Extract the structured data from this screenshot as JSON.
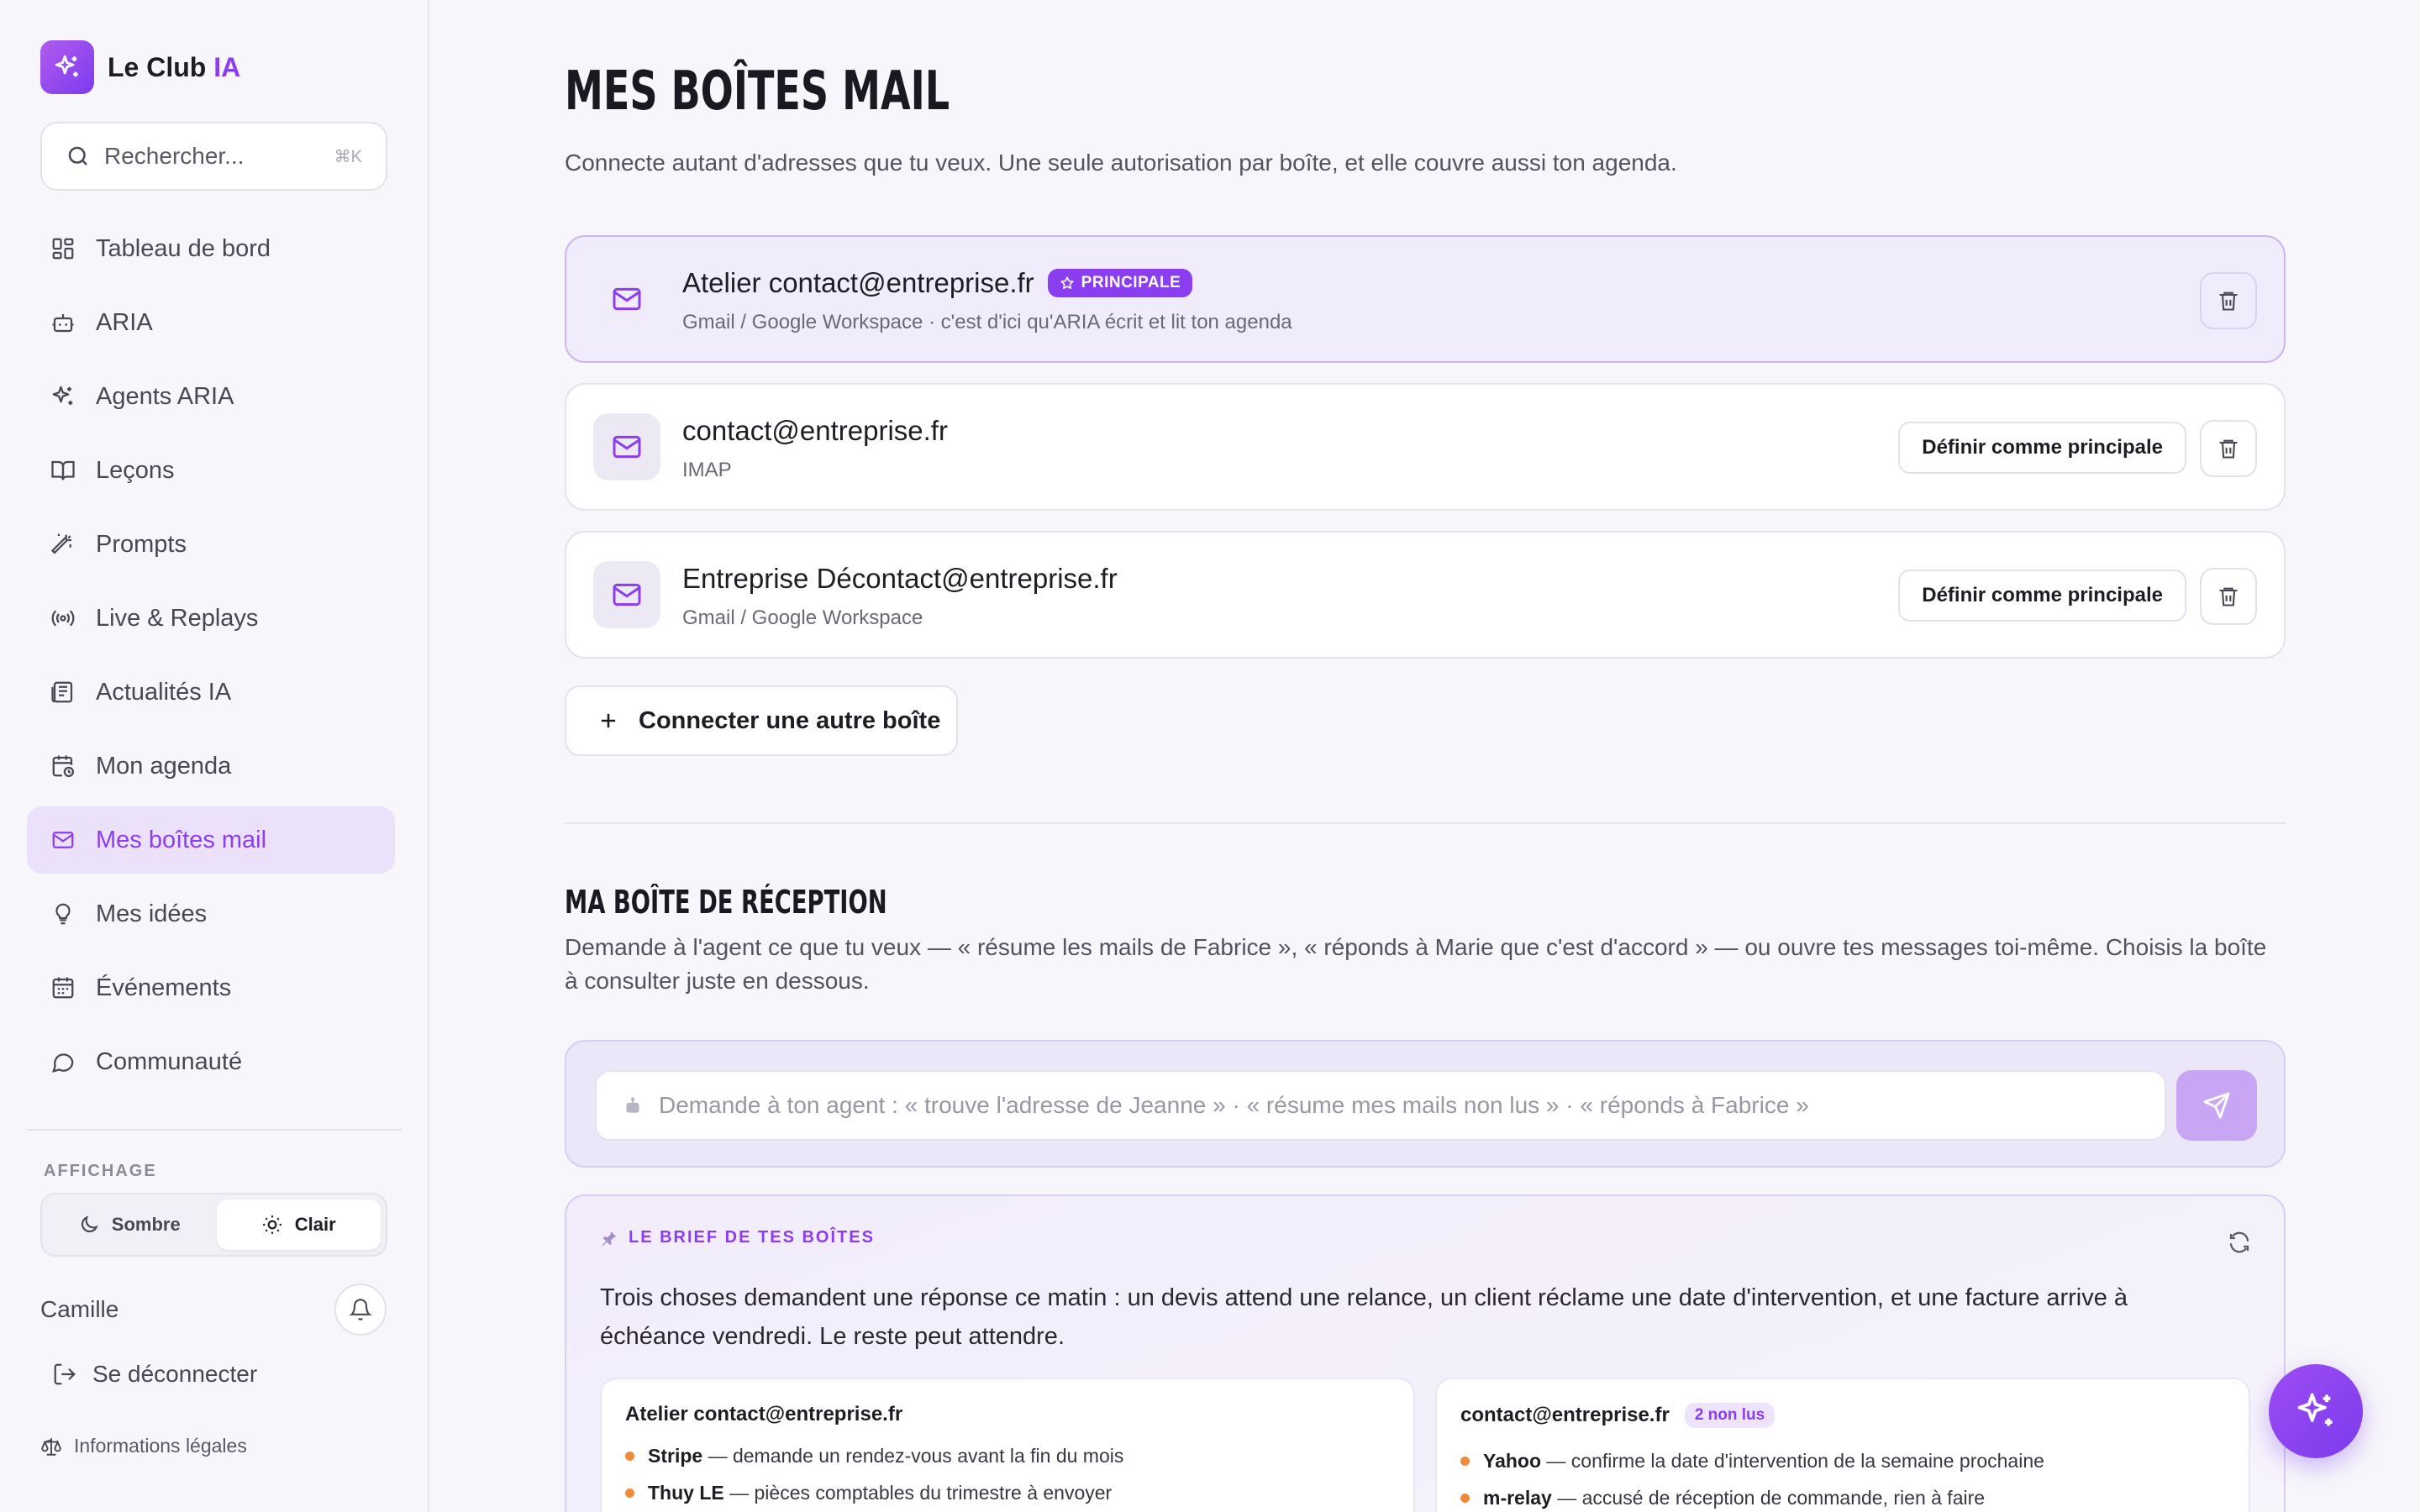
{
  "brand": {
    "name": "Le Club",
    "accent": "IA"
  },
  "search": {
    "placeholder": "Rechercher...",
    "shortcut": "⌘K"
  },
  "nav": {
    "items": [
      {
        "label": "Tableau de bord",
        "icon": "dashboard-icon"
      },
      {
        "label": "ARIA",
        "icon": "bot-icon"
      },
      {
        "label": "Agents ARIA",
        "icon": "sparkles-icon"
      },
      {
        "label": "Leçons",
        "icon": "book-icon"
      },
      {
        "label": "Prompts",
        "icon": "wand-icon"
      },
      {
        "label": "Live & Replays",
        "icon": "broadcast-icon"
      },
      {
        "label": "Actualités IA",
        "icon": "newspaper-icon"
      },
      {
        "label": "Mon agenda",
        "icon": "calendar-clock-icon"
      },
      {
        "label": "Mes boîtes mail",
        "icon": "mail-icon",
        "active": true
      },
      {
        "label": "Mes idées",
        "icon": "lightbulb-icon"
      },
      {
        "label": "Événements",
        "icon": "calendar-icon"
      },
      {
        "label": "Communauté",
        "icon": "chat-icon"
      }
    ]
  },
  "display": {
    "section_label": "AFFICHAGE",
    "dark_label": "Sombre",
    "light_label": "Clair",
    "selected": "Clair"
  },
  "user": {
    "name": "Camille",
    "logout_label": "Se déconnecter",
    "legal_label": "Informations légales"
  },
  "page": {
    "title": "MES BOÎTES MAIL",
    "subtitle": "Connecte autant d'adresses que tu veux. Une seule autorisation par boîte, et elle couvre aussi ton agenda."
  },
  "mailboxes": [
    {
      "name": "Atelier contact@entreprise.fr",
      "badge": "PRINCIPALE",
      "meta": "Gmail / Google Workspace · c'est d'ici qu'ARIA écrit et lit ton agenda",
      "primary": true
    },
    {
      "name": "contact@entreprise.fr",
      "meta": "IMAP",
      "action": "Définir comme principale"
    },
    {
      "name": "Entreprise Décontact@entreprise.fr",
      "meta": "Gmail / Google Workspace",
      "action": "Définir comme principale"
    }
  ],
  "connect_label": "Connecter une autre boîte",
  "inbox": {
    "title": "MA BOÎTE DE RÉCEPTION",
    "subtitle": "Demande à l'agent ce que tu veux — « résume les mails de Fabrice », « réponds à Marie que c'est d'accord » — ou ouvre tes messages toi-même. Choisis la boîte à consulter juste en dessous.",
    "agent_placeholder": "Demande à ton agent : « trouve l'adresse de Jeanne » · « résume mes mails non lus » · « réponds à Fabrice »"
  },
  "brief": {
    "label": "LE BRIEF DE TES BOÎTES",
    "text": "Trois choses demandent une réponse ce matin : un devis attend une relance, un client réclame une date d'intervention, et une facture arrive à échéance vendredi. Le reste peut attendre.",
    "cards": [
      {
        "title": "Atelier contact@entreprise.fr",
        "items": [
          {
            "sender": "Stripe",
            "text": " — demande un rendez-vous avant la fin du mois"
          },
          {
            "sender": "Thuy LE",
            "text": " — pièces comptables du trimestre à envoyer"
          }
        ]
      },
      {
        "title": "contact@entreprise.fr",
        "unread": "2 non lus",
        "items": [
          {
            "sender": "Yahoo",
            "text": " — confirme la date d'intervention de la semaine prochaine"
          },
          {
            "sender": "m-relay",
            "text": " — accusé de réception de commande, rien à faire"
          }
        ]
      }
    ]
  },
  "colors": {
    "accent": "#8b3df0",
    "active_bg": "#ebe1fb",
    "dot": "#f08a3a"
  }
}
